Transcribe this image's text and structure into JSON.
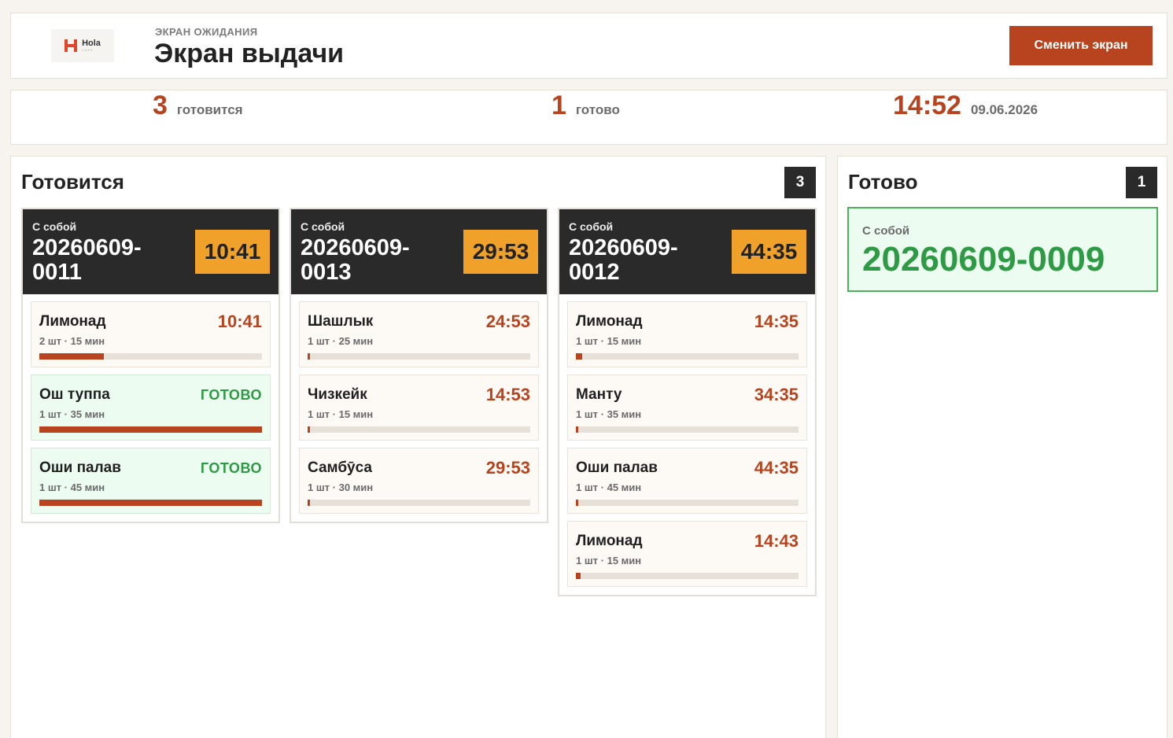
{
  "header": {
    "logo_text": "Hola",
    "logo_tagline": "CAFE",
    "kicker": "ЭКРАН ОЖИДАНИЯ",
    "title": "Экран выдачи",
    "switch_label": "Сменить экран"
  },
  "stats": {
    "preparing_count": "3",
    "preparing_label": "готовится",
    "ready_count": "1",
    "ready_label": "готово",
    "time": "14:52",
    "date": "09.06.2026"
  },
  "preparing": {
    "title": "Готовится",
    "count": "3",
    "orders": [
      {
        "type": "С собой",
        "number": "20260609-0011",
        "timer": "10:41",
        "items": [
          {
            "name": "Лимонад",
            "time": "10:41",
            "meta": "2 шт · 15 мин",
            "progress": 0.29,
            "done": false
          },
          {
            "name": "Ош туппа",
            "time": "ГОТОВО",
            "meta": "1 шт · 35 мин",
            "progress": 1.0,
            "done": true
          },
          {
            "name": "Оши палав",
            "time": "ГОТОВО",
            "meta": "1 шт · 45 мин",
            "progress": 1.0,
            "done": true
          }
        ]
      },
      {
        "type": "С собой",
        "number": "20260609-0013",
        "timer": "29:53",
        "items": [
          {
            "name": "Шашлык",
            "time": "24:53",
            "meta": "1 шт · 25 мин",
            "progress": 0.01,
            "done": false
          },
          {
            "name": "Чизкейк",
            "time": "14:53",
            "meta": "1 шт · 15 мин",
            "progress": 0.01,
            "done": false
          },
          {
            "name": "Самбӯса",
            "time": "29:53",
            "meta": "1 шт · 30 мин",
            "progress": 0.01,
            "done": false
          }
        ]
      },
      {
        "type": "С собой",
        "number": "20260609-0012",
        "timer": "44:35",
        "items": [
          {
            "name": "Лимонад",
            "time": "14:35",
            "meta": "1 шт · 15 мин",
            "progress": 0.03,
            "done": false
          },
          {
            "name": "Манту",
            "time": "34:35",
            "meta": "1 шт · 35 мин",
            "progress": 0.01,
            "done": false
          },
          {
            "name": "Оши палав",
            "time": "44:35",
            "meta": "1 шт · 45 мин",
            "progress": 0.01,
            "done": false
          },
          {
            "name": "Лимонад",
            "time": "14:43",
            "meta": "1 шт · 15 мин",
            "progress": 0.02,
            "done": false
          }
        ]
      }
    ]
  },
  "ready": {
    "title": "Готово",
    "count": "1",
    "orders": [
      {
        "type": "С собой",
        "number": "20260609-0009"
      }
    ]
  },
  "colors": {
    "accent": "#b7441f",
    "timer_badge": "#f0a12a",
    "ready_green": "#2e9a44",
    "dark": "#2a2a2a"
  }
}
